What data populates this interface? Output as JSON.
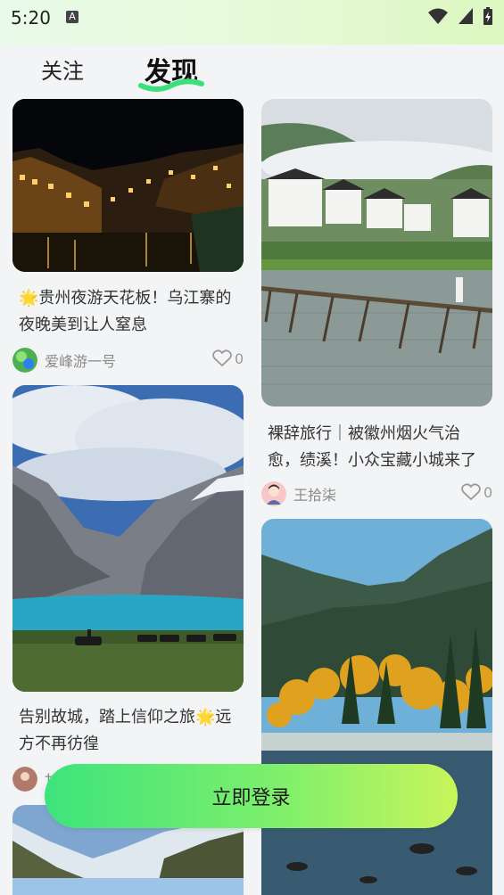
{
  "status_bar": {
    "time": "5:20"
  },
  "tabs": {
    "follow": "关注",
    "discover": "发现"
  },
  "feed": {
    "left": [
      {
        "title": "🌟贵州夜游天花板！乌江寨的夜晚美到让人窒息",
        "author": "爱峰游一号",
        "likes": "0"
      },
      {
        "title": "告别故城，踏上信仰之旅🌟远方不再彷徨",
        "author": "甘"
      }
    ],
    "right": [
      {
        "title": "裸辞旅行｜被徽州烟火气治愈，绩溪！小众宝藏小城来了",
        "author": "王拾柒",
        "likes": "0"
      }
    ]
  },
  "login_button": "立即登录",
  "colors": {
    "accent_green": "#3de47c",
    "accent_lime": "#c8f55a",
    "background": "#f3f4f6"
  }
}
